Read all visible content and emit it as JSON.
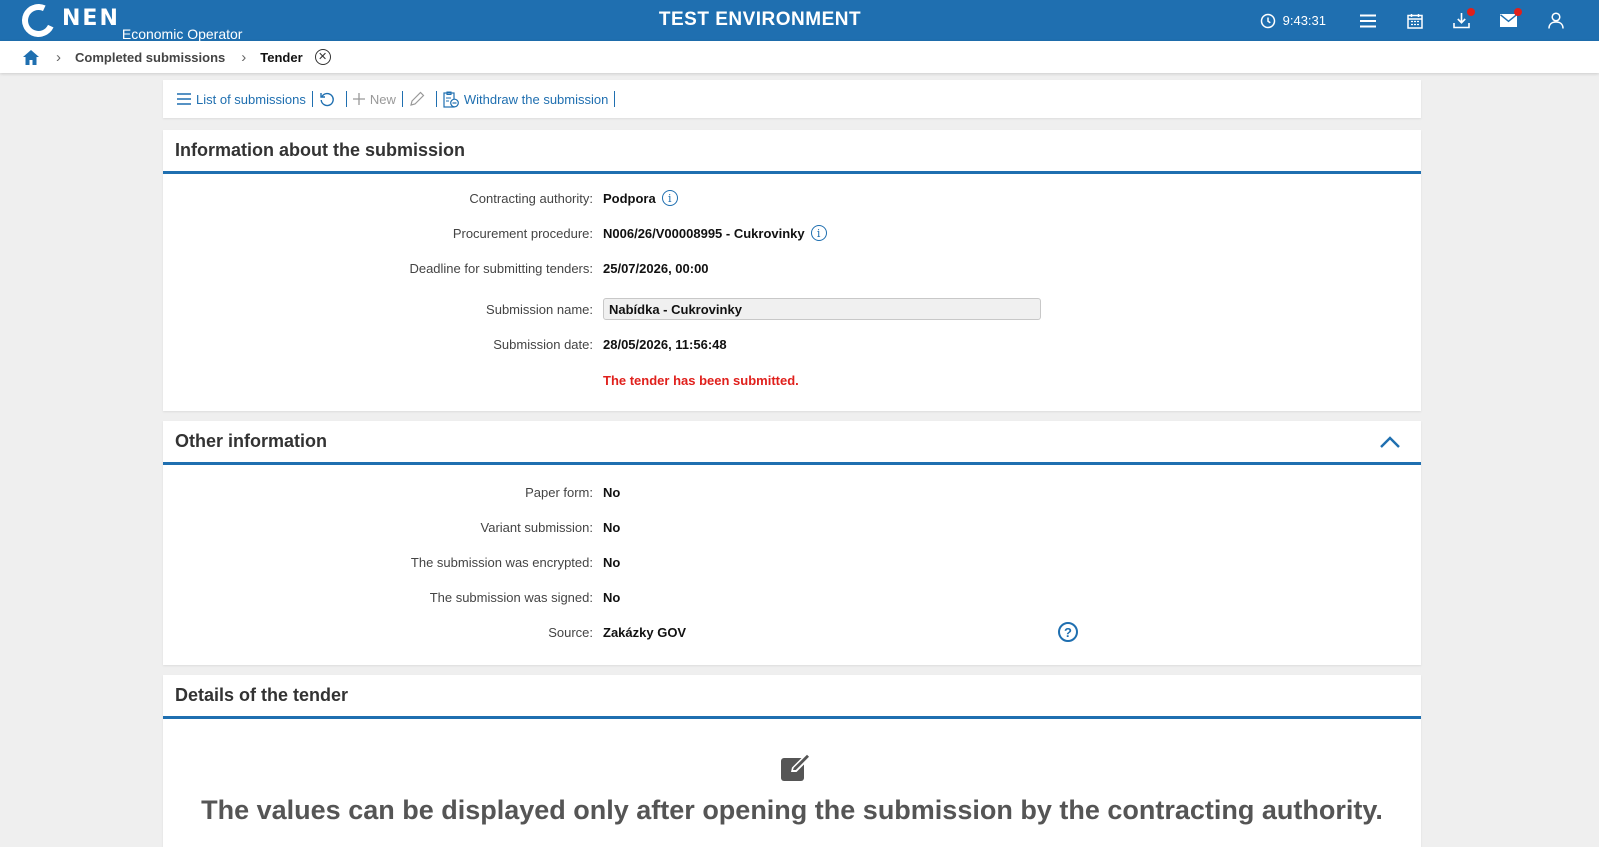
{
  "app": {
    "logo_text": "NEN",
    "logo_subtitle": "Economic Operator",
    "env_title": "TEST ENVIRONMENT",
    "clock": "9:43:31",
    "accent_color": "#1f6fb0"
  },
  "breadcrumb": {
    "items": [
      "Completed submissions",
      "Tender"
    ]
  },
  "toolbar": {
    "list_label": "List of submissions",
    "new_label": "New",
    "withdraw_label": "Withdraw the submission"
  },
  "info_panel": {
    "title": "Information about the submission",
    "contracting_authority_label": "Contracting authority:",
    "contracting_authority_value": "Podpora",
    "procedure_label": "Procurement procedure:",
    "procedure_value": "N006/26/V00008995 - Cukrovinky",
    "deadline_label": "Deadline for submitting tenders:",
    "deadline_value": "25/07/2026, 00:00",
    "name_label": "Submission name:",
    "name_value": "Nabídka - Cukrovinky",
    "date_label": "Submission date:",
    "date_value": "28/05/2026, 11:56:48",
    "status_text": "The tender has been submitted."
  },
  "other_panel": {
    "title": "Other information",
    "paper_label": "Paper form:",
    "paper_value": "No",
    "variant_label": "Variant submission:",
    "variant_value": "No",
    "encrypted_label": "The submission was encrypted:",
    "encrypted_value": "No",
    "signed_label": "The submission was signed:",
    "signed_value": "No",
    "source_label": "Source:",
    "source_value": "Zakázky GOV"
  },
  "details_panel": {
    "title": "Details of the tender",
    "message": "The values can be displayed only after opening the submission by the contracting authority."
  }
}
